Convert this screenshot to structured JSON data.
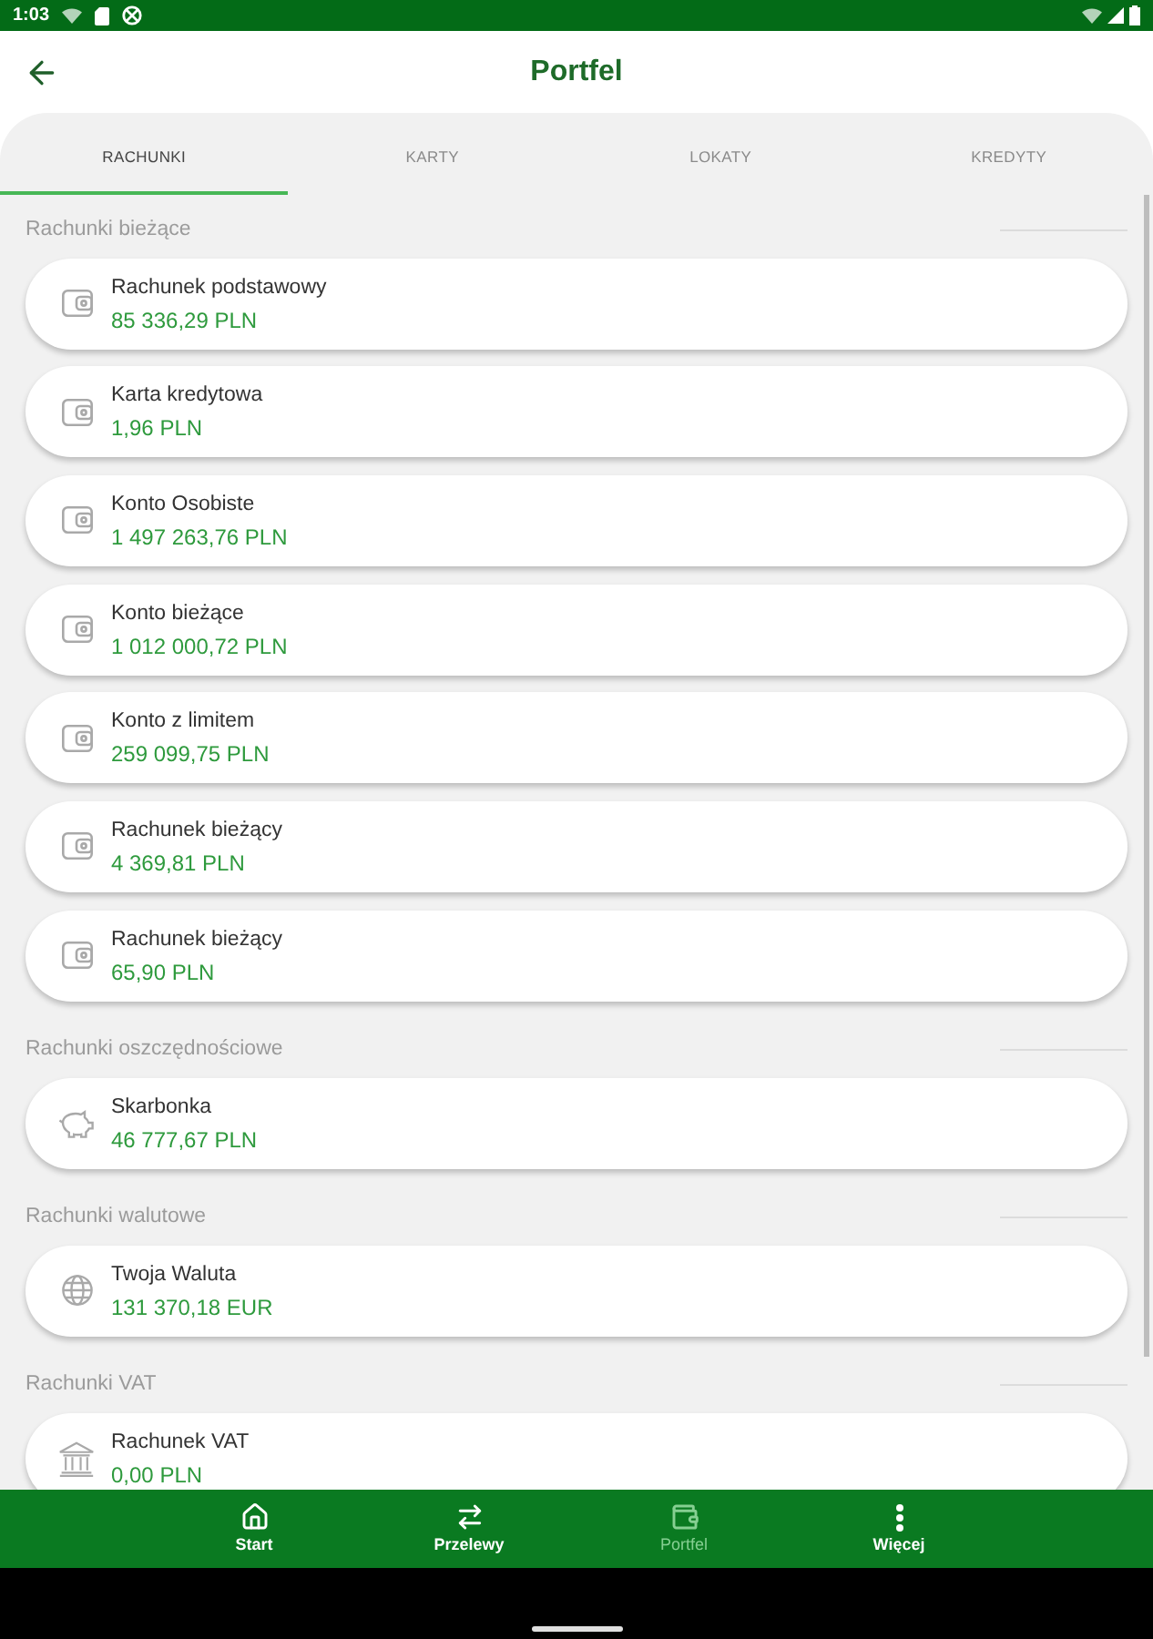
{
  "status_bar": {
    "time": "1:03"
  },
  "header": {
    "title": "Portfel"
  },
  "tabs": [
    {
      "label": "RACHUNKI",
      "selected": true
    },
    {
      "label": "KARTY",
      "selected": false
    },
    {
      "label": "LOKATY",
      "selected": false
    },
    {
      "label": "KREDYTY",
      "selected": false
    }
  ],
  "sections": [
    {
      "title": "Rachunki bieżące",
      "accounts": [
        {
          "kind": "wallet",
          "name": "Rachunek podstawowy",
          "balance": "85 336,29 PLN"
        },
        {
          "kind": "wallet",
          "name": "Karta kredytowa",
          "balance": "1,96 PLN"
        },
        {
          "kind": "wallet",
          "name": "Konto Osobiste",
          "balance": "1 497 263,76 PLN"
        },
        {
          "kind": "wallet",
          "name": "Konto bieżące",
          "balance": "1 012 000,72 PLN"
        },
        {
          "kind": "wallet",
          "name": "Konto z limitem",
          "balance": "259 099,75 PLN"
        },
        {
          "kind": "wallet",
          "name": "Rachunek bieżący",
          "balance": "4 369,81 PLN"
        },
        {
          "kind": "wallet",
          "name": "Rachunek bieżący",
          "balance": "65,90 PLN"
        }
      ]
    },
    {
      "title": "Rachunki oszczędnościowe",
      "accounts": [
        {
          "kind": "piggy",
          "name": "Skarbonka",
          "balance": "46 777,67 PLN"
        }
      ]
    },
    {
      "title": "Rachunki walutowe",
      "accounts": [
        {
          "kind": "globe",
          "name": "Twoja Waluta",
          "balance": "131 370,18 EUR"
        }
      ]
    },
    {
      "title": "Rachunki VAT",
      "accounts": [
        {
          "kind": "bank",
          "name": "Rachunek VAT",
          "balance": "0,00 PLN"
        }
      ]
    }
  ],
  "bottom_nav": [
    {
      "kind": "home",
      "label": "Start",
      "selected": false
    },
    {
      "kind": "transfer",
      "label": "Przelewy",
      "selected": false
    },
    {
      "kind": "wallet",
      "label": "Portfel",
      "selected": true
    },
    {
      "kind": "more",
      "label": "Więcej",
      "selected": false
    }
  ]
}
